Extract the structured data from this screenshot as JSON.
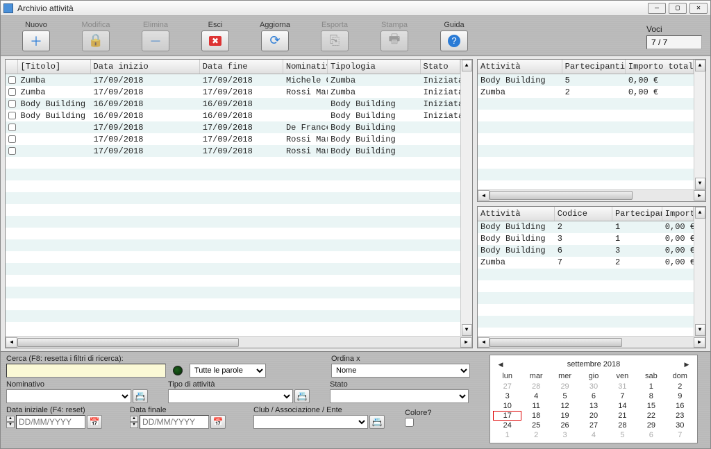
{
  "window": {
    "title": "Archivio attività"
  },
  "toolbar": {
    "nuovo": "Nuovo",
    "modifica": "Modifica",
    "elimina": "Elimina",
    "esci": "Esci",
    "aggiorna": "Aggiorna",
    "esporta": "Esporta",
    "stampa": "Stampa",
    "guida": "Guida",
    "voci_label": "Voci",
    "voci_value": "7 / 7"
  },
  "mainGrid": {
    "headers": {
      "titolo": "[Titolo]",
      "dataInizio": "Data inizio",
      "dataFine": "Data fine",
      "nominativo": "Nominativo",
      "tipologia": "Tipologia",
      "stato": "Stato"
    },
    "rows": [
      {
        "titolo": "Zumba",
        "inizio": "17/09/2018",
        "fine": "17/09/2018",
        "nominativo": "Michele Ce",
        "tipologia": "Zumba",
        "stato": "Iniziata"
      },
      {
        "titolo": "Zumba",
        "inizio": "17/09/2018",
        "fine": "17/09/2018",
        "nominativo": "Rossi Mari",
        "tipologia": "Zumba",
        "stato": "Iniziata"
      },
      {
        "titolo": "Body Building",
        "inizio": "16/09/2018",
        "fine": "16/09/2018",
        "nominativo": "",
        "tipologia": "Body Building",
        "stato": "Iniziata"
      },
      {
        "titolo": "Body Building",
        "inizio": "16/09/2018",
        "fine": "16/09/2018",
        "nominativo": "",
        "tipologia": "Body Building",
        "stato": "Iniziata"
      },
      {
        "titolo": "",
        "inizio": "17/09/2018",
        "fine": "17/09/2018",
        "nominativo": "De Frances",
        "tipologia": "Body Building",
        "stato": ""
      },
      {
        "titolo": "",
        "inizio": "17/09/2018",
        "fine": "17/09/2018",
        "nominativo": "Rossi Mari",
        "tipologia": "Body Building",
        "stato": ""
      },
      {
        "titolo": "",
        "inizio": "17/09/2018",
        "fine": "17/09/2018",
        "nominativo": "Rossi Mari",
        "tipologia": "Body Building",
        "stato": ""
      }
    ]
  },
  "rightTop": {
    "headers": {
      "attivita": "Attività",
      "partecipanti": "Partecipanti",
      "importo": "Importo totale"
    },
    "rows": [
      {
        "attivita": "Body Building",
        "part": "5",
        "imp": "0,00 €"
      },
      {
        "attivita": "Zumba",
        "part": "2",
        "imp": "0,00 €"
      }
    ]
  },
  "rightBottom": {
    "headers": {
      "attivita": "Attività",
      "codice": "Codice",
      "partecipanti": "Partecipanti",
      "importo": "Import"
    },
    "rows": [
      {
        "attivita": "Body Building",
        "codice": "2",
        "part": "1",
        "imp": "0,00 €"
      },
      {
        "attivita": "Body Building",
        "codice": "3",
        "part": "1",
        "imp": "0,00 €"
      },
      {
        "attivita": "Body Building",
        "codice": "6",
        "part": "3",
        "imp": "0,00 €"
      },
      {
        "attivita": "Zumba",
        "codice": "7",
        "part": "2",
        "imp": "0,00 €"
      }
    ]
  },
  "filters": {
    "cerca_label": "Cerca (F8: resetta i filtri di ricerca):",
    "parole_opt": "Tutte le parole",
    "ordina_label": "Ordina x",
    "ordina_opt": "Nome",
    "nominativo_label": "Nominativo",
    "tipoattivita_label": "Tipo di attività",
    "stato_label": "Stato",
    "dataini_label": "Data iniziale (F4: reset)",
    "datafin_label": "Data finale",
    "club_label": "Club / Associazione / Ente",
    "colore_label": "Colore?",
    "date_placeholder": "DD/MM/YYYY"
  },
  "calendar": {
    "title": "settembre 2018",
    "dow": [
      "lun",
      "mar",
      "mer",
      "gio",
      "ven",
      "sab",
      "dom"
    ],
    "weeks": [
      [
        {
          "d": "27",
          "o": true
        },
        {
          "d": "28",
          "o": true
        },
        {
          "d": "29",
          "o": true
        },
        {
          "d": "30",
          "o": true
        },
        {
          "d": "31",
          "o": true
        },
        {
          "d": "1"
        },
        {
          "d": "2"
        }
      ],
      [
        {
          "d": "3"
        },
        {
          "d": "4"
        },
        {
          "d": "5"
        },
        {
          "d": "6"
        },
        {
          "d": "7"
        },
        {
          "d": "8"
        },
        {
          "d": "9"
        }
      ],
      [
        {
          "d": "10"
        },
        {
          "d": "11"
        },
        {
          "d": "12"
        },
        {
          "d": "13"
        },
        {
          "d": "14"
        },
        {
          "d": "15"
        },
        {
          "d": "16"
        }
      ],
      [
        {
          "d": "17",
          "today": true
        },
        {
          "d": "18"
        },
        {
          "d": "19"
        },
        {
          "d": "20"
        },
        {
          "d": "21"
        },
        {
          "d": "22"
        },
        {
          "d": "23"
        }
      ],
      [
        {
          "d": "24"
        },
        {
          "d": "25"
        },
        {
          "d": "26"
        },
        {
          "d": "27"
        },
        {
          "d": "28"
        },
        {
          "d": "29"
        },
        {
          "d": "30"
        }
      ],
      [
        {
          "d": "1",
          "o": true
        },
        {
          "d": "2",
          "o": true
        },
        {
          "d": "3",
          "o": true
        },
        {
          "d": "4",
          "o": true
        },
        {
          "d": "5",
          "o": true
        },
        {
          "d": "6",
          "o": true
        },
        {
          "d": "7",
          "o": true
        }
      ]
    ]
  }
}
